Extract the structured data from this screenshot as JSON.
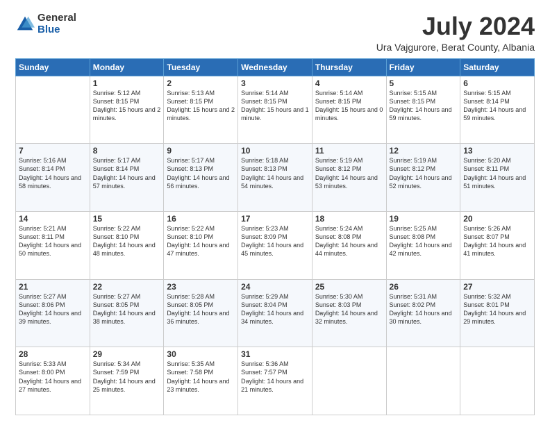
{
  "logo": {
    "general": "General",
    "blue": "Blue"
  },
  "title": "July 2024",
  "subtitle": "Ura Vajgurore, Berat County, Albania",
  "days_of_week": [
    "Sunday",
    "Monday",
    "Tuesday",
    "Wednesday",
    "Thursday",
    "Friday",
    "Saturday"
  ],
  "weeks": [
    [
      {
        "day": "",
        "sunrise": "",
        "sunset": "",
        "daylight": ""
      },
      {
        "day": "1",
        "sunrise": "Sunrise: 5:12 AM",
        "sunset": "Sunset: 8:15 PM",
        "daylight": "Daylight: 15 hours and 2 minutes."
      },
      {
        "day": "2",
        "sunrise": "Sunrise: 5:13 AM",
        "sunset": "Sunset: 8:15 PM",
        "daylight": "Daylight: 15 hours and 2 minutes."
      },
      {
        "day": "3",
        "sunrise": "Sunrise: 5:14 AM",
        "sunset": "Sunset: 8:15 PM",
        "daylight": "Daylight: 15 hours and 1 minute."
      },
      {
        "day": "4",
        "sunrise": "Sunrise: 5:14 AM",
        "sunset": "Sunset: 8:15 PM",
        "daylight": "Daylight: 15 hours and 0 minutes."
      },
      {
        "day": "5",
        "sunrise": "Sunrise: 5:15 AM",
        "sunset": "Sunset: 8:15 PM",
        "daylight": "Daylight: 14 hours and 59 minutes."
      },
      {
        "day": "6",
        "sunrise": "Sunrise: 5:15 AM",
        "sunset": "Sunset: 8:14 PM",
        "daylight": "Daylight: 14 hours and 59 minutes."
      }
    ],
    [
      {
        "day": "7",
        "sunrise": "Sunrise: 5:16 AM",
        "sunset": "Sunset: 8:14 PM",
        "daylight": "Daylight: 14 hours and 58 minutes."
      },
      {
        "day": "8",
        "sunrise": "Sunrise: 5:17 AM",
        "sunset": "Sunset: 8:14 PM",
        "daylight": "Daylight: 14 hours and 57 minutes."
      },
      {
        "day": "9",
        "sunrise": "Sunrise: 5:17 AM",
        "sunset": "Sunset: 8:13 PM",
        "daylight": "Daylight: 14 hours and 56 minutes."
      },
      {
        "day": "10",
        "sunrise": "Sunrise: 5:18 AM",
        "sunset": "Sunset: 8:13 PM",
        "daylight": "Daylight: 14 hours and 54 minutes."
      },
      {
        "day": "11",
        "sunrise": "Sunrise: 5:19 AM",
        "sunset": "Sunset: 8:12 PM",
        "daylight": "Daylight: 14 hours and 53 minutes."
      },
      {
        "day": "12",
        "sunrise": "Sunrise: 5:19 AM",
        "sunset": "Sunset: 8:12 PM",
        "daylight": "Daylight: 14 hours and 52 minutes."
      },
      {
        "day": "13",
        "sunrise": "Sunrise: 5:20 AM",
        "sunset": "Sunset: 8:11 PM",
        "daylight": "Daylight: 14 hours and 51 minutes."
      }
    ],
    [
      {
        "day": "14",
        "sunrise": "Sunrise: 5:21 AM",
        "sunset": "Sunset: 8:11 PM",
        "daylight": "Daylight: 14 hours and 50 minutes."
      },
      {
        "day": "15",
        "sunrise": "Sunrise: 5:22 AM",
        "sunset": "Sunset: 8:10 PM",
        "daylight": "Daylight: 14 hours and 48 minutes."
      },
      {
        "day": "16",
        "sunrise": "Sunrise: 5:22 AM",
        "sunset": "Sunset: 8:10 PM",
        "daylight": "Daylight: 14 hours and 47 minutes."
      },
      {
        "day": "17",
        "sunrise": "Sunrise: 5:23 AM",
        "sunset": "Sunset: 8:09 PM",
        "daylight": "Daylight: 14 hours and 45 minutes."
      },
      {
        "day": "18",
        "sunrise": "Sunrise: 5:24 AM",
        "sunset": "Sunset: 8:08 PM",
        "daylight": "Daylight: 14 hours and 44 minutes."
      },
      {
        "day": "19",
        "sunrise": "Sunrise: 5:25 AM",
        "sunset": "Sunset: 8:08 PM",
        "daylight": "Daylight: 14 hours and 42 minutes."
      },
      {
        "day": "20",
        "sunrise": "Sunrise: 5:26 AM",
        "sunset": "Sunset: 8:07 PM",
        "daylight": "Daylight: 14 hours and 41 minutes."
      }
    ],
    [
      {
        "day": "21",
        "sunrise": "Sunrise: 5:27 AM",
        "sunset": "Sunset: 8:06 PM",
        "daylight": "Daylight: 14 hours and 39 minutes."
      },
      {
        "day": "22",
        "sunrise": "Sunrise: 5:27 AM",
        "sunset": "Sunset: 8:05 PM",
        "daylight": "Daylight: 14 hours and 38 minutes."
      },
      {
        "day": "23",
        "sunrise": "Sunrise: 5:28 AM",
        "sunset": "Sunset: 8:05 PM",
        "daylight": "Daylight: 14 hours and 36 minutes."
      },
      {
        "day": "24",
        "sunrise": "Sunrise: 5:29 AM",
        "sunset": "Sunset: 8:04 PM",
        "daylight": "Daylight: 14 hours and 34 minutes."
      },
      {
        "day": "25",
        "sunrise": "Sunrise: 5:30 AM",
        "sunset": "Sunset: 8:03 PM",
        "daylight": "Daylight: 14 hours and 32 minutes."
      },
      {
        "day": "26",
        "sunrise": "Sunrise: 5:31 AM",
        "sunset": "Sunset: 8:02 PM",
        "daylight": "Daylight: 14 hours and 30 minutes."
      },
      {
        "day": "27",
        "sunrise": "Sunrise: 5:32 AM",
        "sunset": "Sunset: 8:01 PM",
        "daylight": "Daylight: 14 hours and 29 minutes."
      }
    ],
    [
      {
        "day": "28",
        "sunrise": "Sunrise: 5:33 AM",
        "sunset": "Sunset: 8:00 PM",
        "daylight": "Daylight: 14 hours and 27 minutes."
      },
      {
        "day": "29",
        "sunrise": "Sunrise: 5:34 AM",
        "sunset": "Sunset: 7:59 PM",
        "daylight": "Daylight: 14 hours and 25 minutes."
      },
      {
        "day": "30",
        "sunrise": "Sunrise: 5:35 AM",
        "sunset": "Sunset: 7:58 PM",
        "daylight": "Daylight: 14 hours and 23 minutes."
      },
      {
        "day": "31",
        "sunrise": "Sunrise: 5:36 AM",
        "sunset": "Sunset: 7:57 PM",
        "daylight": "Daylight: 14 hours and 21 minutes."
      },
      {
        "day": "",
        "sunrise": "",
        "sunset": "",
        "daylight": ""
      },
      {
        "day": "",
        "sunrise": "",
        "sunset": "",
        "daylight": ""
      },
      {
        "day": "",
        "sunrise": "",
        "sunset": "",
        "daylight": ""
      }
    ]
  ]
}
